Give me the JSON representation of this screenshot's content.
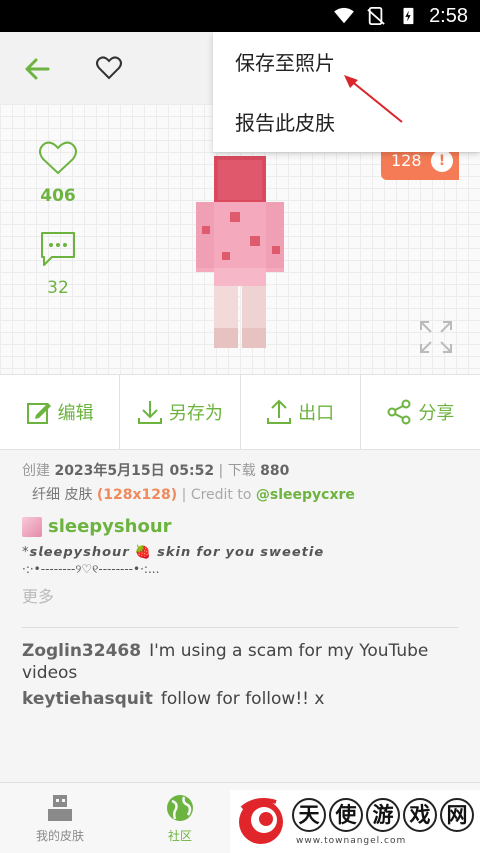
{
  "status_bar": {
    "time": "2:58"
  },
  "stats": {
    "likes": "406",
    "comments": "32"
  },
  "resolution_badge": "128",
  "menu": {
    "items": [
      "保存至照片",
      "报告此皮肤"
    ]
  },
  "actions": [
    {
      "label": "编辑",
      "icon": "edit-icon"
    },
    {
      "label": "另存为",
      "icon": "download-icon"
    },
    {
      "label": "出口",
      "icon": "upload-icon"
    },
    {
      "label": "分享",
      "icon": "share-icon"
    }
  ],
  "info": {
    "created_label": "创建",
    "created_date": "2023年5月15日 05:52",
    "downloads_label": "下载",
    "downloads": "880",
    "type_label": "纤细 皮肤",
    "resolution": "(128x128)",
    "credit_label": "Credit to",
    "credit_user": "@sleepycxre",
    "author": "sleepyshour",
    "description_line1": "*𝙨𝙡𝙚𝙚𝙥𝙮𝙨𝙝𝙤𝙪𝙧 🍓 𝙨𝙠𝙞𝙣 𝙛𝙤𝙧 𝙮𝙤𝙪 𝙨𝙬𝙚𝙚𝙩𝙞𝙚",
    "description_line2": "·:·•--------୨♡୧--------•·:...",
    "more": "更多"
  },
  "comments": [
    {
      "user": "Zoglin32468",
      "text": "I'm using a scam for my YouTube videos"
    },
    {
      "user": "keytiehasquit",
      "text": "follow for follow!! x"
    }
  ],
  "bottom_nav": [
    {
      "label": "我的皮肤",
      "icon": "my-skins-icon"
    },
    {
      "label": "社区",
      "icon": "globe-icon"
    }
  ],
  "watermark": {
    "chars": [
      "天",
      "使",
      "游",
      "戏",
      "网"
    ],
    "url": "www.townangel.com"
  },
  "colors": {
    "accent": "#6db33f",
    "badge": "#f47b55"
  }
}
